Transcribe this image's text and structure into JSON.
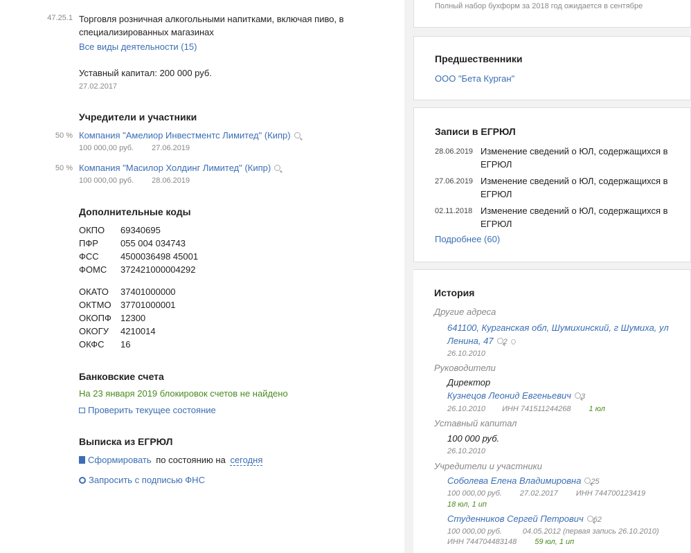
{
  "activity": {
    "code": "47.25.1",
    "text_line1": "Торговля розничная алкогольными напитками, включая пиво, в",
    "text_line2": "специализированных магазинах",
    "all_link": "Все виды деятельности (15)"
  },
  "capital": {
    "label": "Уставный капитал: 200 000 руб.",
    "date": "27.02.2017"
  },
  "founders": {
    "title": "Учредители и участники",
    "items": [
      {
        "share": "50 %",
        "name": "Компания \"Амелиор Инвестментс Лимитед\" (Кипр)",
        "amount": "100 000,00 руб.",
        "date": "27.06.2019"
      },
      {
        "share": "50 %",
        "name": "Компания \"Масилор Холдинг Лимитед\" (Кипр)",
        "amount": "100 000,00 руб.",
        "date": "28.06.2019"
      }
    ]
  },
  "codes": {
    "title": "Дополнительные коды",
    "group1": [
      {
        "k": "ОКПО",
        "v": "69340695"
      },
      {
        "k": "ПФР",
        "v": "055 004 034743"
      },
      {
        "k": "ФСС",
        "v": "4500036498 45001"
      },
      {
        "k": "ФОМС",
        "v": "372421000004292"
      }
    ],
    "group2": [
      {
        "k": "ОКАТО",
        "v": "37401000000"
      },
      {
        "k": "ОКТМО",
        "v": "37701000001"
      },
      {
        "k": "ОКОПФ",
        "v": "12300"
      },
      {
        "k": "ОКОГУ",
        "v": "4210014"
      },
      {
        "k": "ОКФС",
        "v": "16"
      }
    ]
  },
  "bank": {
    "title": "Банковские счета",
    "status": "На 23 января 2019 блокировок счетов не найдено",
    "check_link": "Проверить текущее состояние"
  },
  "extract": {
    "title": "Выписка из ЕГРЮЛ",
    "form_link": "Сформировать",
    "form_mid": "по состоянию на",
    "form_date": "сегодня",
    "request_link": "Запросить с подписью ФНС"
  },
  "side_top_note": "Полный набор бухформ за 2018 год ожидается в сентябре",
  "predecessors": {
    "title": "Предшественники",
    "link": "ООО \"Бета Курган\""
  },
  "egrul": {
    "title": "Записи в ЕГРЮЛ",
    "records": [
      {
        "date": "28.06.2019",
        "line1": "Изменение сведений о ЮЛ, содержащихся в",
        "line2": "ЕГРЮЛ"
      },
      {
        "date": "27.06.2019",
        "line1": "Изменение сведений о ЮЛ, содержащихся в",
        "line2": "ЕГРЮЛ"
      },
      {
        "date": "02.11.2018",
        "line1": "Изменение сведений о ЮЛ, содержащихся в",
        "line2": "ЕГРЮЛ"
      }
    ],
    "more_link": "Подробнее (60)"
  },
  "history": {
    "title": "История",
    "addr_label": "Другие адреса",
    "addr_line1": "641100, Курганская обл, Шумихинский, г Шумиха, ул",
    "addr_line2": "Ленина, 47",
    "addr_count": "2",
    "addr_date": "26.10.2010",
    "heads_label": "Руководители",
    "head_role": "Директор",
    "head_name": "Кузнецов Леонид Евгеньевич",
    "head_count": "3",
    "head_date": "26.10.2010",
    "head_inn": "ИНН 741511244268",
    "head_ul": "1 юл",
    "cap_label": "Уставный капитал",
    "cap_value": "100 000 руб.",
    "cap_date": "26.10.2010",
    "founders_label": "Учредители и участники",
    "f1_name": "Соболева Елена Владимировна",
    "f1_count": "25",
    "f1_amount": "100 000,00 руб.",
    "f1_date": "27.02.2017",
    "f1_inn": "ИНН 744700123419",
    "f1_ul": "18 юл, 1 ип",
    "f2_name": "Студенников Сергей Петрович",
    "f2_count": "62",
    "f2_amount": "100 000,00 руб.",
    "f2_date": "04.05.2012 (первая запись 26.10.2010)",
    "f2_inn": "ИНН 744704483148",
    "f2_ul": "59 юл, 1 ип"
  }
}
